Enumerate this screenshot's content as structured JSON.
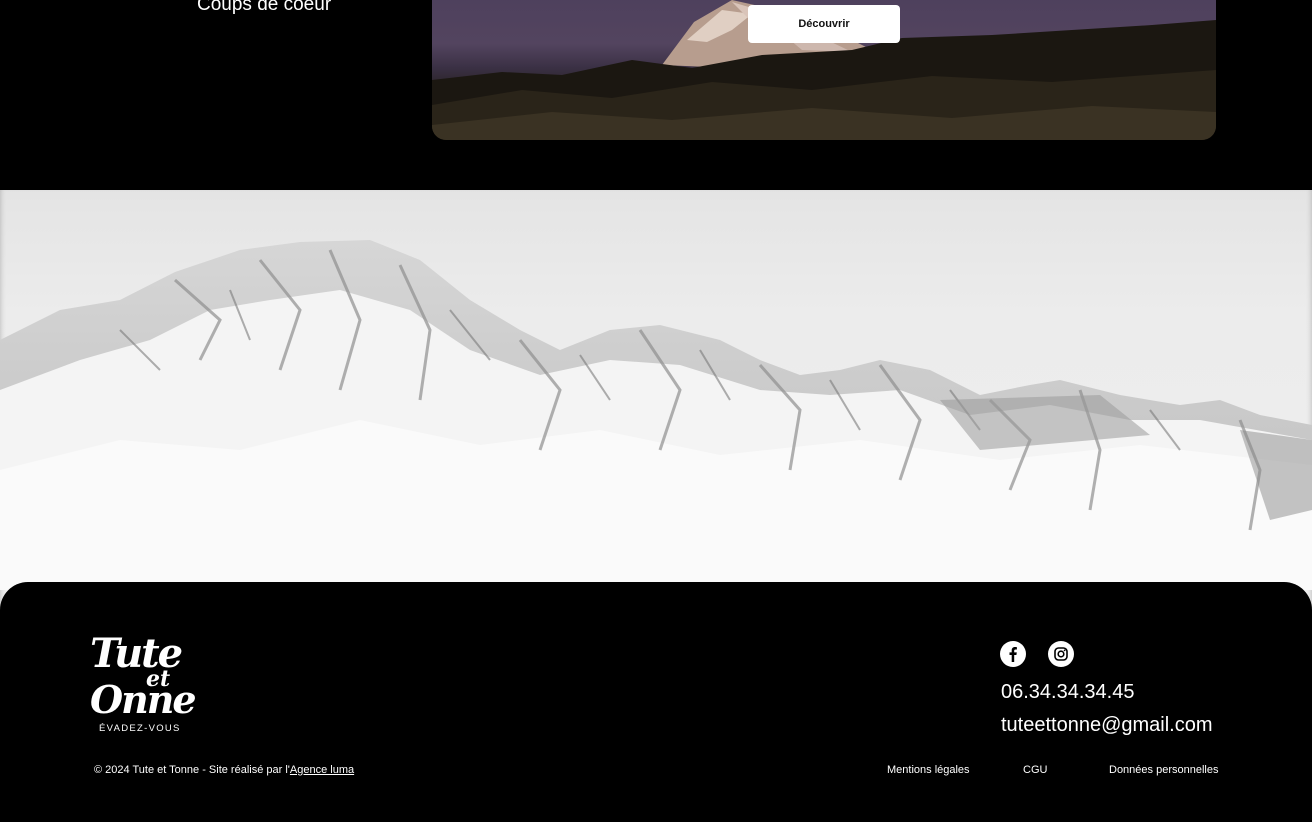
{
  "top_section": {
    "heading": "Coups de coeur",
    "discover_label": "Découvrir"
  },
  "footer": {
    "logo": {
      "line1": "Tute",
      "line_et": "et",
      "line2": "Onne",
      "tagline": "ÉVADEZ-VOUS"
    },
    "social": [
      {
        "icon": "facebook-icon"
      },
      {
        "icon": "instagram-icon"
      }
    ],
    "phone": "06.34.34.34.45",
    "email": "tuteettonne@gmail.com",
    "copyright_text": "© 2024 Tute et Tonne - Site réalisé par l'",
    "agency_link": "Agence luma",
    "links": {
      "legal_mentions": "Mentions légales",
      "cgu": "CGU",
      "personal_data": "Données personnelles"
    }
  },
  "colors": {
    "background": "#000000",
    "text": "#ffffff",
    "button_bg": "#ffffff",
    "button_text": "#111111",
    "sky": "#ececec"
  }
}
